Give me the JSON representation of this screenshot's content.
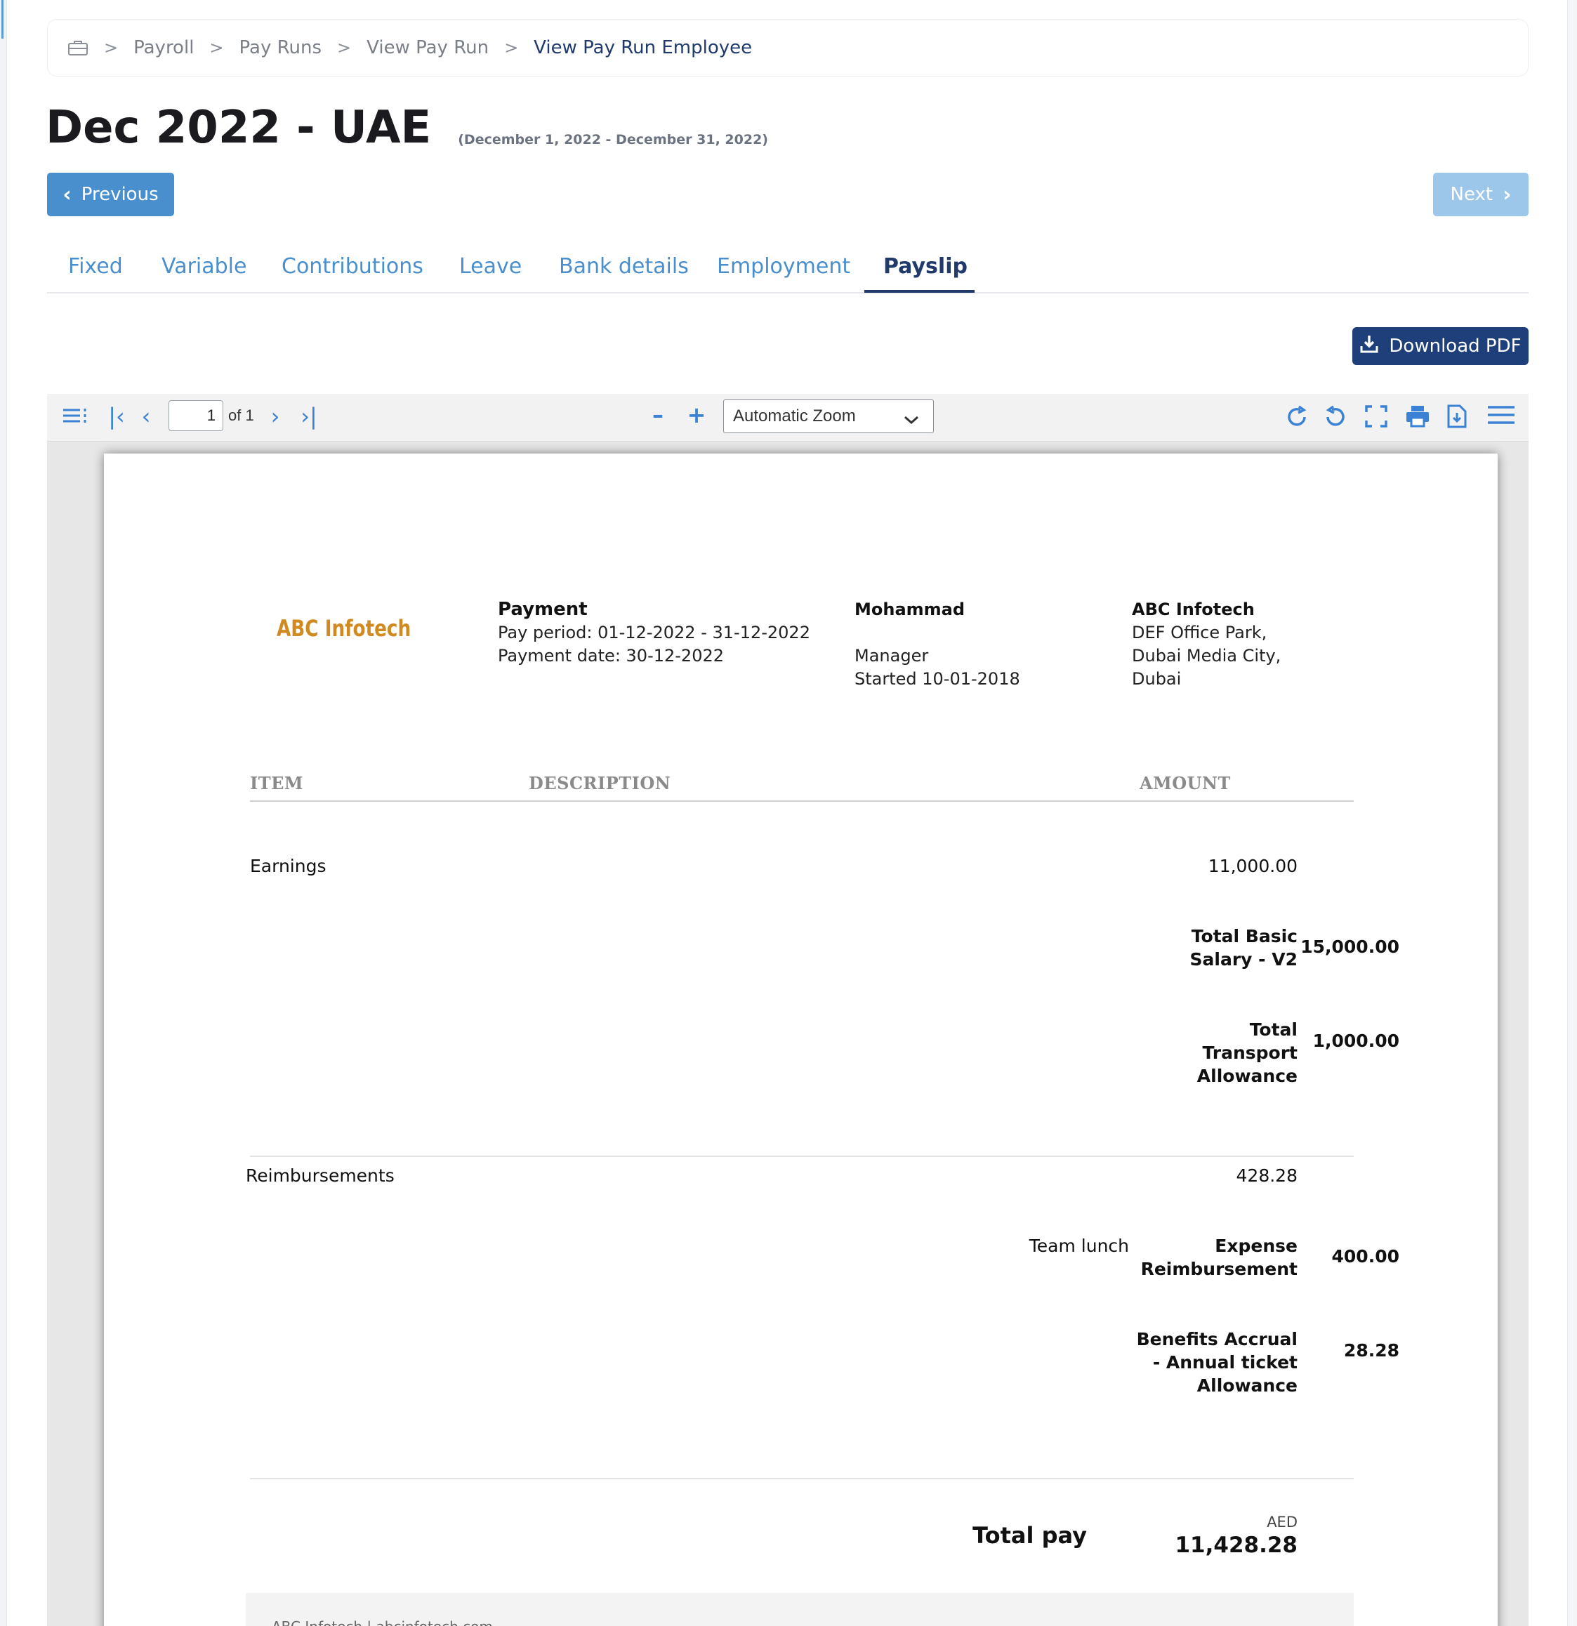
{
  "breadcrumb": {
    "items": [
      "Payroll",
      "Pay Runs",
      "View Pay Run",
      "View Pay Run Employee"
    ],
    "separator": ">"
  },
  "header": {
    "title": "Dec 2022 - UAE",
    "period": "(December 1, 2022 - December 31, 2022)"
  },
  "nav": {
    "previous_label": "Previous",
    "next_label": "Next"
  },
  "tabs": [
    {
      "label": "Fixed"
    },
    {
      "label": "Variable"
    },
    {
      "label": "Contributions"
    },
    {
      "label": "Leave"
    },
    {
      "label": "Bank details"
    },
    {
      "label": "Employment"
    },
    {
      "label": "Payslip",
      "active": true
    }
  ],
  "download_label": "Download PDF",
  "viewer": {
    "page_number": "1",
    "page_count": "of 1",
    "zoom": "Automatic Zoom",
    "accent": "#3c82d4"
  },
  "payslip": {
    "logo_text": "ABC Infotech",
    "payment": {
      "heading": "Payment",
      "pay_period": "Pay period: 01-12-2022 - 31-12-2022",
      "payment_date": "Payment date: 30-12-2022"
    },
    "employee": {
      "name": "Mohammad",
      "role": "Manager",
      "started": "Started 10-01-2018"
    },
    "company": {
      "name": "ABC Infotech",
      "address1": "DEF Office Park,",
      "address2": "Dubai Media City,",
      "address3": "Dubai"
    },
    "columns": {
      "item": "ITEM",
      "description": "DESCRIPTION",
      "amount": "AMOUNT"
    },
    "earnings": {
      "label": "Earnings",
      "total": "11,000.00",
      "lines": [
        {
          "label_1": "Total Basic",
          "label_2": "Salary - V2",
          "amount": "15,000.00"
        },
        {
          "label_1": "Total",
          "label_2": "Transport",
          "label_3": "Allowance",
          "amount": "1,000.00"
        }
      ]
    },
    "reimbursements": {
      "label": "Reimbursements",
      "total": "428.28",
      "lines": [
        {
          "description": "Team lunch",
          "label_1": "Expense",
          "label_2": "Reimbursement",
          "amount": "400.00"
        },
        {
          "label_1": "Benefits Accrual",
          "label_2": "- Annual ticket",
          "label_3": "Allowance",
          "amount": "28.28"
        }
      ]
    },
    "total": {
      "label": "Total pay",
      "currency": "AED",
      "amount": "11,428.28"
    },
    "footer": "ABC Infotech | abcinfotech.com"
  },
  "colors": {
    "primary": "#4a8fcd",
    "primary_light": "#9cc6ea",
    "navy": "#1f3a6b",
    "download_bg": "#1e3f7a",
    "logo": "#d08a1f"
  },
  "icons": {
    "breadcrumb_home": "briefcase-icon",
    "viewer": [
      "sidebar-toggle-icon",
      "first-page-icon",
      "previous-page-icon",
      "next-page-icon",
      "last-page-icon",
      "zoom-out-icon",
      "zoom-in-icon",
      "rotate-clockwise-icon",
      "rotate-counterclockwise-icon",
      "fullscreen-icon",
      "print-icon",
      "download-icon",
      "tools-menu-icon"
    ]
  }
}
